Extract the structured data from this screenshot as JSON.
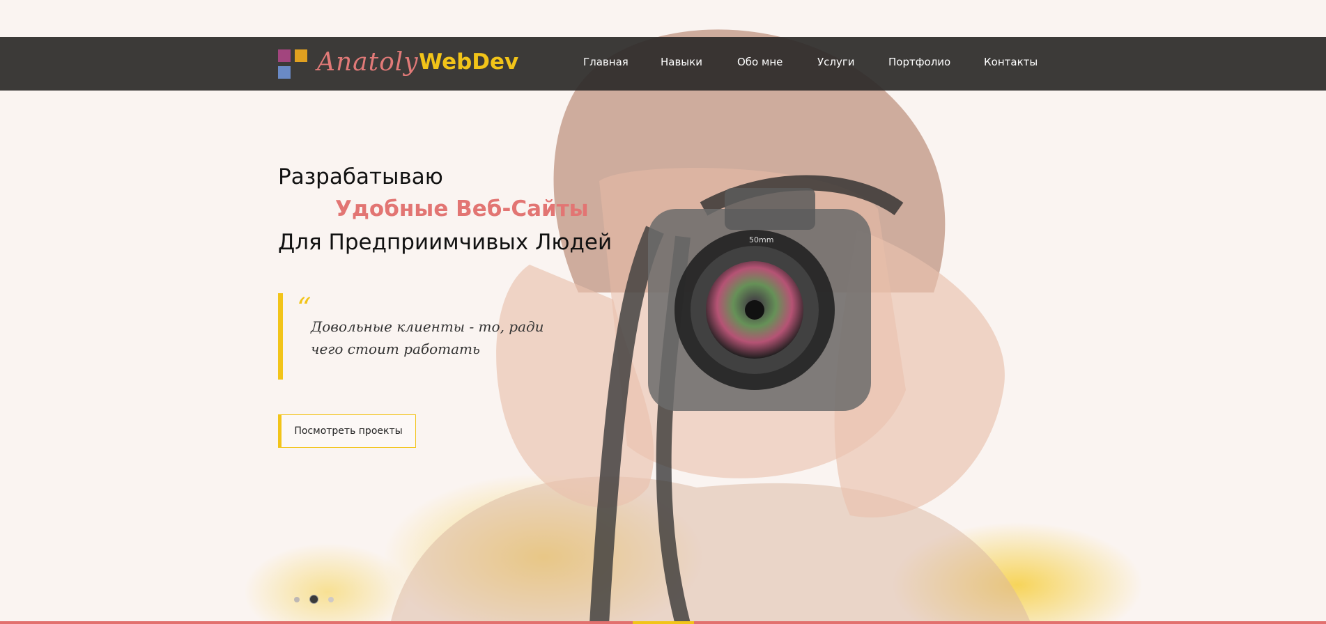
{
  "logo": {
    "part1": "Anatoly",
    "part2": "WebDev",
    "colors": [
      "#a2457e",
      "#e0a020",
      "#6a8ac6"
    ]
  },
  "nav": {
    "items": [
      "Главная",
      "Навыки",
      "Обо мне",
      "Услуги",
      "Портфолио",
      "Контакты"
    ]
  },
  "hero": {
    "line1": "Разрабатываю",
    "line2": "Удобные Веб-Сайты",
    "line3": "Для Предприимчивых Людей",
    "quote_mark": "“",
    "quote": "Довольные клиенты - то, ради чего стоит работать",
    "button": "Посмотреть проекты"
  },
  "slider": {
    "count": 3,
    "active_index": 1
  },
  "theme": {
    "accent": "#f2c419",
    "brand": "#e27a78",
    "nav_bg": "#2d2b2a"
  }
}
